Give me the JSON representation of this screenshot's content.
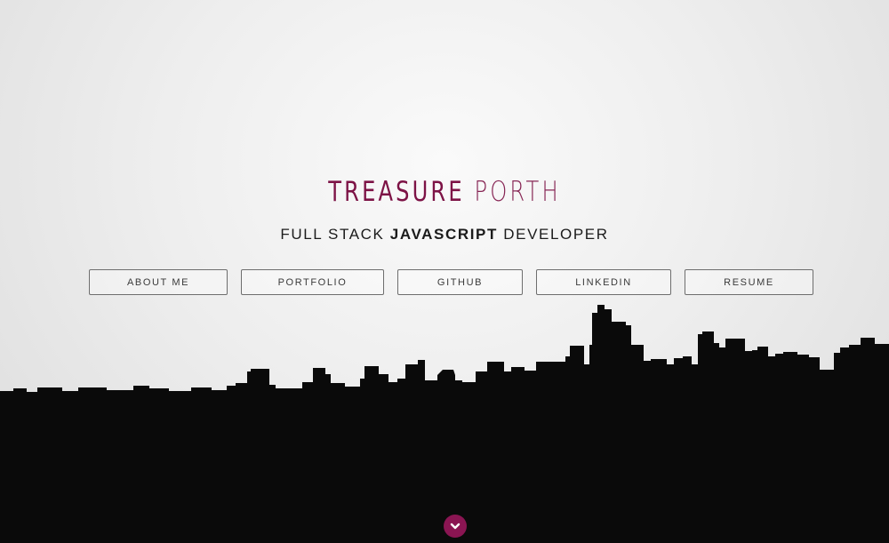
{
  "hero": {
    "name_first": "TREASURE",
    "name_last": "PORTH",
    "subtitle_pre": "FULL STACK ",
    "subtitle_bold": "JAVASCRIPT",
    "subtitle_post": " DEVELOPER"
  },
  "nav": {
    "about": "ABOUT ME",
    "portfolio": "PORTFOLIO",
    "github": "GITHUB",
    "linkedin": "LINKEDIN",
    "resume": "RESUME"
  },
  "icons": {
    "scroll_down": "chevron-down-circle-icon"
  },
  "colors": {
    "accent": "#7d1346",
    "skyline": "#0a0a0a",
    "background": "#eeeeee"
  }
}
